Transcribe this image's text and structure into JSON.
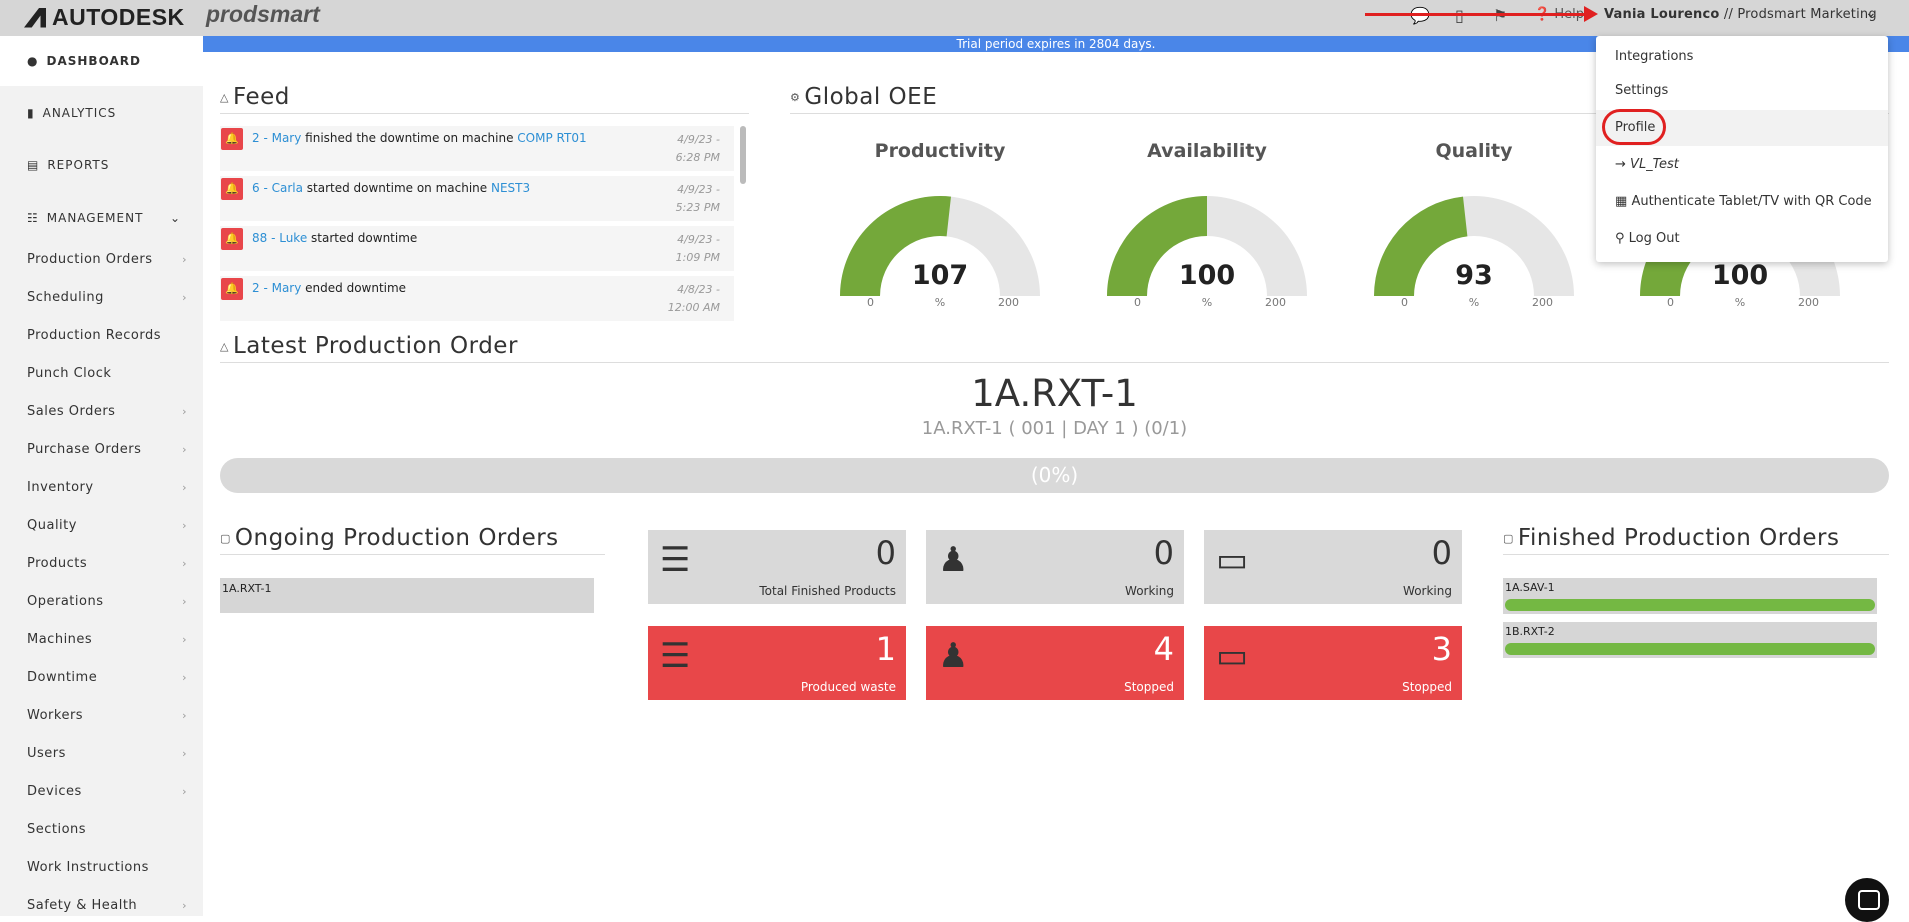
{
  "header": {
    "brand": "AUTODESK",
    "product": "prodsmart",
    "help_label": "Help",
    "user_name": "Vania Lourenco",
    "company": "// Prodsmart Marketing",
    "trial_notice": "Trial period expires in 2804 days."
  },
  "sidebar": {
    "dashboard": "DASHBOARD",
    "analytics": "ANALYTICS",
    "reports": "REPORTS",
    "management": "MANAGEMENT",
    "items": [
      {
        "label": "Production Orders",
        "chevron": true
      },
      {
        "label": "Scheduling",
        "chevron": true
      },
      {
        "label": "Production Records",
        "chevron": false
      },
      {
        "label": "Punch Clock",
        "chevron": false
      },
      {
        "label": "Sales Orders",
        "chevron": true
      },
      {
        "label": "Purchase Orders",
        "chevron": true
      },
      {
        "label": "Inventory",
        "chevron": true
      },
      {
        "label": "Quality",
        "chevron": true
      },
      {
        "label": "Products",
        "chevron": true
      },
      {
        "label": "Operations",
        "chevron": true
      },
      {
        "label": "Machines",
        "chevron": true
      },
      {
        "label": "Downtime",
        "chevron": true
      },
      {
        "label": "Workers",
        "chevron": true
      },
      {
        "label": "Users",
        "chevron": true
      },
      {
        "label": "Devices",
        "chevron": true
      },
      {
        "label": "Sections",
        "chevron": false
      },
      {
        "label": "Work Instructions",
        "chevron": false
      },
      {
        "label": "Safety & Health",
        "chevron": true
      }
    ]
  },
  "feed": {
    "title": "Feed",
    "items": [
      {
        "actor": "2 - Mary",
        "text": " finished the downtime on machine ",
        "target": "COMP RT01",
        "date": "4/9/23 -",
        "time": "6:28 PM"
      },
      {
        "actor": "6 - Carla",
        "text": " started downtime on machine ",
        "target": "NEST3",
        "date": "4/9/23 -",
        "time": "5:23 PM"
      },
      {
        "actor": "88 - Luke",
        "text": " started downtime",
        "target": "",
        "date": "4/9/23 -",
        "time": "1:09 PM"
      },
      {
        "actor": "2 - Mary",
        "text": " ended downtime",
        "target": "",
        "date": "4/8/23 -",
        "time": "12:00 AM"
      }
    ]
  },
  "oee": {
    "title": "Global OEE",
    "gauges": [
      {
        "title": "Productivity",
        "value": 107,
        "unit": "%",
        "min": "0",
        "max": "200"
      },
      {
        "title": "Availability",
        "value": 100,
        "unit": "%",
        "min": "0",
        "max": "200"
      },
      {
        "title": "Quality",
        "value": 93,
        "unit": "%",
        "min": "0",
        "max": "200"
      },
      {
        "title": "",
        "value": 100,
        "unit": "%",
        "min": "0",
        "max": "200"
      }
    ]
  },
  "latest_order": {
    "title": "Latest Production Order",
    "name": "1A.RXT-1",
    "detail": "1A.RXT-1 ( 001 | DAY 1 ) (0/1)",
    "progress_label": "(0%)",
    "progress": 0
  },
  "ongoing": {
    "title": "Ongoing Production Orders",
    "items": [
      "1A.RXT-1"
    ]
  },
  "tiles": [
    {
      "icon": "list-icon",
      "value": "0",
      "label": "Total Finished Products",
      "status": "grey"
    },
    {
      "icon": "worker-icon",
      "value": "0",
      "label": "Working",
      "status": "grey"
    },
    {
      "icon": "machine-icon",
      "value": "0",
      "label": "Working",
      "status": "grey"
    },
    {
      "icon": "list-icon",
      "value": "1",
      "label": "Produced waste",
      "status": "red"
    },
    {
      "icon": "worker-icon",
      "value": "4",
      "label": "Stopped",
      "status": "red"
    },
    {
      "icon": "machine-icon",
      "value": "3",
      "label": "Stopped",
      "status": "red"
    }
  ],
  "finished": {
    "title": "Finished Production Orders",
    "items": [
      {
        "name": "1A.SAV-1",
        "progress": 1
      },
      {
        "name": "1B.RXT-2",
        "progress": 1
      }
    ]
  },
  "user_menu": {
    "items": [
      "Integrations",
      "Settings",
      "Profile",
      "VL_Test",
      "Authenticate Tablet/TV with QR Code",
      "Log Out"
    ]
  },
  "colors": {
    "accent_blue": "#4a86e8",
    "gauge_green": "#74a83a",
    "alert_red": "#e84749",
    "link_blue": "#2d8fd4"
  }
}
